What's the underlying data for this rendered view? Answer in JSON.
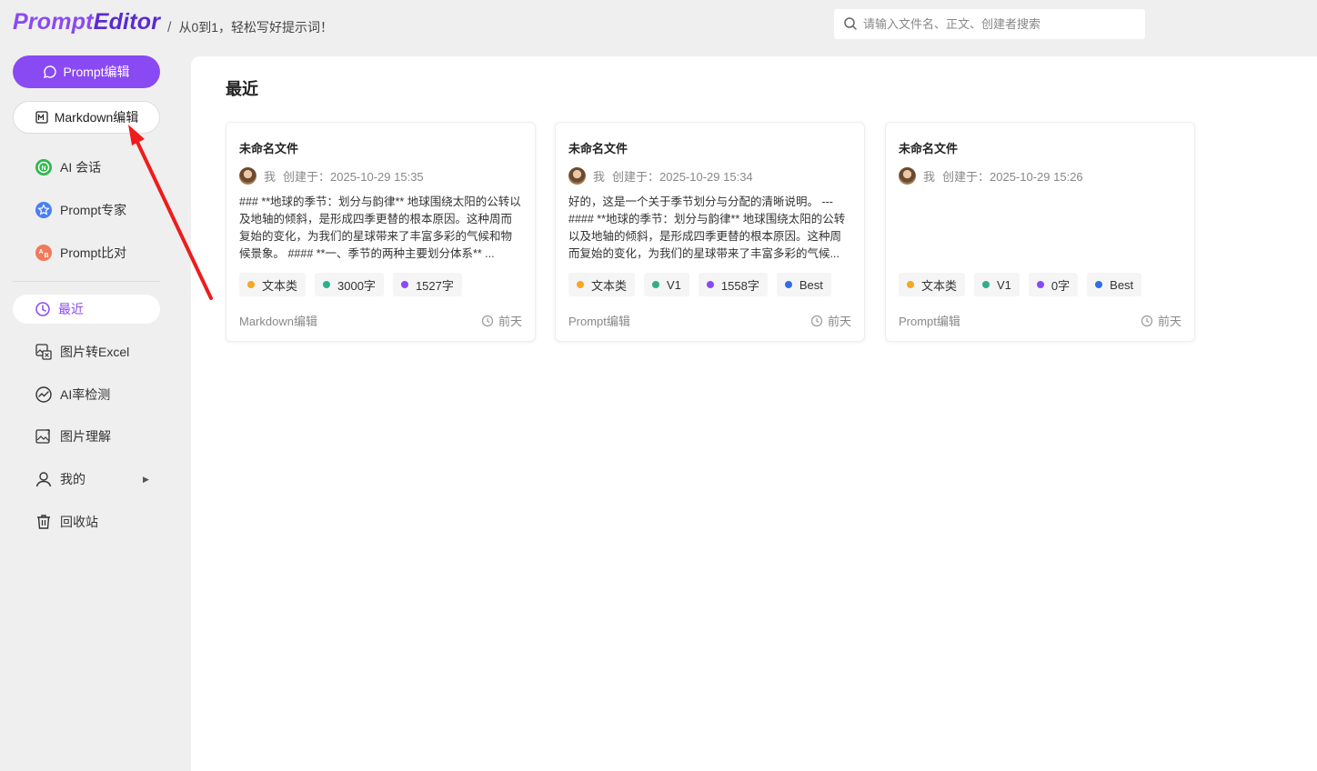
{
  "header": {
    "logo_part1": "Prompt",
    "logo_part2": "Editor",
    "separator": "/",
    "slogan": "从0到1，轻松写好提示词！",
    "search_placeholder": "请输入文件名、正文、创建者搜索"
  },
  "sidebar": {
    "primary_button": "Prompt编辑",
    "secondary_button": "Markdown编辑",
    "tools": [
      {
        "label": "AI 会话",
        "icon": "ai-chat-icon"
      },
      {
        "label": "Prompt专家",
        "icon": "star-badge-icon"
      },
      {
        "label": "Prompt比对",
        "icon": "ab-compare-icon"
      }
    ],
    "active_item": "最近",
    "items": [
      {
        "label": "图片转Excel",
        "icon": "image-excel-icon"
      },
      {
        "label": "AI率检测",
        "icon": "trend-chart-icon"
      },
      {
        "label": "图片理解",
        "icon": "image-question-icon"
      },
      {
        "label": "我的",
        "icon": "user-icon"
      },
      {
        "label": "回收站",
        "icon": "trash-icon"
      }
    ]
  },
  "main": {
    "title": "最近",
    "cards": [
      {
        "title": "未命名文件",
        "author": "我",
        "created": "创建于：2025-10-29 15:35",
        "body": "### **地球的季节：划分与韵律** 地球围绕太阳的公转以及地轴的倾斜，是形成四季更替的根本原因。这种周而复始的变化，为我们的星球带来了丰富多彩的气候和物候景象。 #### **一、季节的两种主要划分体系** ...",
        "tags": [
          {
            "label": "文本类",
            "color": "#f5a623"
          },
          {
            "label": "3000字",
            "color": "#2fae8a"
          },
          {
            "label": "1527字",
            "color": "#8a4af3"
          }
        ],
        "source": "Markdown编辑",
        "time": "前天"
      },
      {
        "title": "未命名文件",
        "author": "我",
        "created": "创建于：2025-10-29 15:34",
        "body": "好的，这是一个关于季节划分与分配的清晰说明。 --- #### **地球的季节：划分与韵律** 地球围绕太阳的公转以及地轴的倾斜，是形成四季更替的根本原因。这种周而复始的变化，为我们的星球带来了丰富多彩的气候...",
        "tags": [
          {
            "label": "文本类",
            "color": "#f5a623"
          },
          {
            "label": "V1",
            "color": "#2fae8a"
          },
          {
            "label": "1558字",
            "color": "#8a4af3"
          },
          {
            "label": "Best",
            "color": "#2f6fe4"
          }
        ],
        "source": "Prompt编辑",
        "time": "前天"
      },
      {
        "title": "未命名文件",
        "author": "我",
        "created": "创建于：2025-10-29 15:26",
        "body": "",
        "tags": [
          {
            "label": "文本类",
            "color": "#f5a623"
          },
          {
            "label": "V1",
            "color": "#2fae8a"
          },
          {
            "label": "0字",
            "color": "#8a4af3"
          },
          {
            "label": "Best",
            "color": "#2f6fe4"
          }
        ],
        "source": "Prompt编辑",
        "time": "前天"
      }
    ]
  },
  "colors": {
    "accent": "#8a4af3",
    "annotation_arrow": "#ee1c1c"
  }
}
